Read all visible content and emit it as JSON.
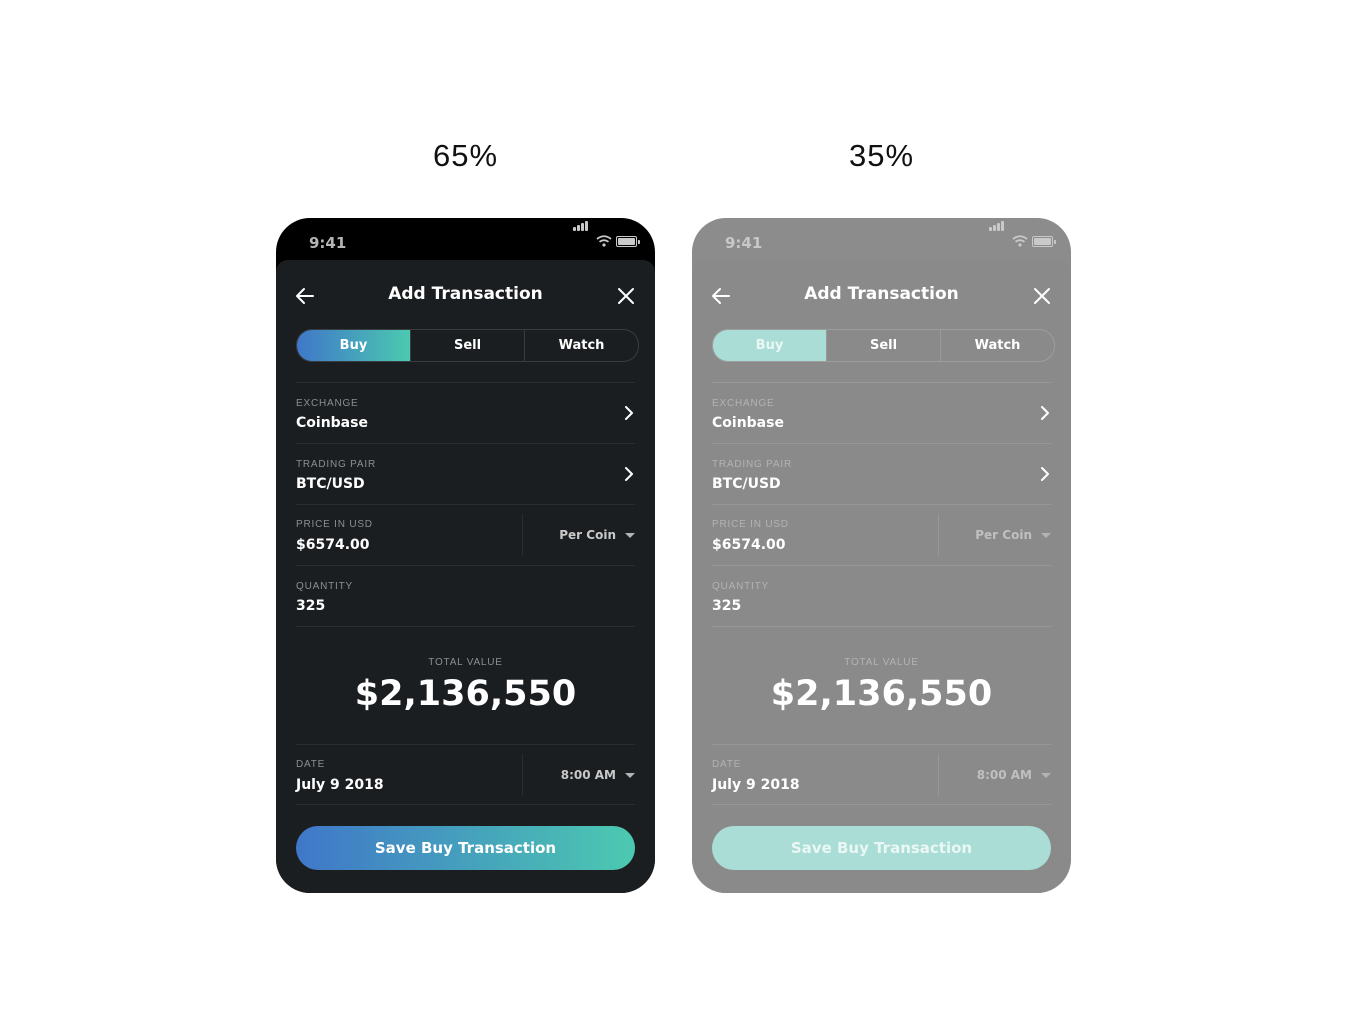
{
  "variants": [
    {
      "opacity_label": "65%",
      "status": {
        "time": "9:41"
      },
      "header": {
        "title": "Add Transaction"
      },
      "tabs": [
        "Buy",
        "Sell",
        "Watch"
      ],
      "exchange": {
        "label": "EXCHANGE",
        "value": "Coinbase"
      },
      "pair": {
        "label": "TRADING PAIR",
        "value": "BTC/USD"
      },
      "price": {
        "label": "PRICE IN USD",
        "value": "$6574.00",
        "mode": "Per Coin"
      },
      "quantity": {
        "label": "QUANTITY",
        "value": "325"
      },
      "total": {
        "label": "TOTAL VALUE",
        "value": "$2,136,550"
      },
      "date": {
        "label": "DATE",
        "value": "July 9 2018",
        "time": "8:00 AM"
      },
      "save_label": "Save Buy Transaction"
    },
    {
      "opacity_label": "35%",
      "status": {
        "time": "9:41"
      },
      "header": {
        "title": "Add Transaction"
      },
      "tabs": [
        "Buy",
        "Sell",
        "Watch"
      ],
      "exchange": {
        "label": "EXCHANGE",
        "value": "Coinbase"
      },
      "pair": {
        "label": "TRADING PAIR",
        "value": "BTC/USD"
      },
      "price": {
        "label": "PRICE IN USD",
        "value": "$6574.00",
        "mode": "Per Coin"
      },
      "quantity": {
        "label": "QUANTITY",
        "value": "325"
      },
      "total": {
        "label": "TOTAL VALUE",
        "value": "$2,136,550"
      },
      "date": {
        "label": "DATE",
        "value": "July 9 2018",
        "time": "8:00 AM"
      },
      "save_label": "Save Buy Transaction"
    }
  ],
  "colors": {
    "gradient_start": "#3f77c9",
    "gradient_end": "#4cc9b0",
    "sheet_dark": "#1b1e20",
    "phone_gray": "#8c8c8c",
    "mint_muted": "#a9ddd6"
  }
}
